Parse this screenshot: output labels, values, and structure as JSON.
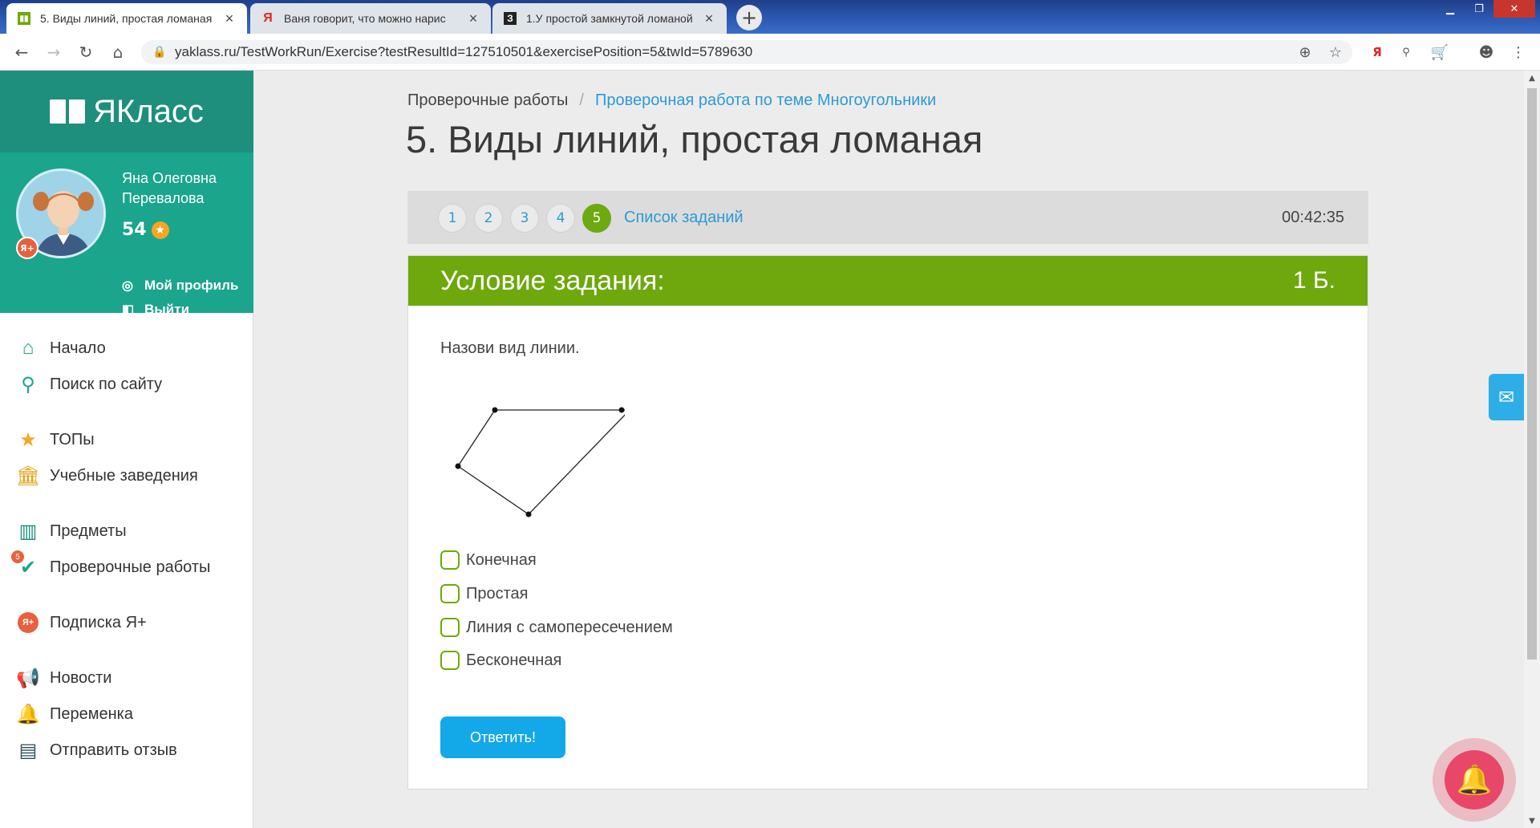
{
  "browser": {
    "tabs": [
      {
        "title": "5. Виды линий, простая ломаная",
        "favicon": "Я"
      },
      {
        "title": "Ваня говорит, что можно нарис",
        "favicon": "Я"
      },
      {
        "title": "1.У простой замкнутой ломаной",
        "favicon": "З"
      }
    ],
    "new_tab": "+",
    "url": "yaklass.ru/TestWorkRun/Exercise?testResultId=127510501&exercisePosition=5&twId=5789630",
    "yandex_label": "Я"
  },
  "sidebar": {
    "logo": "ЯКласс",
    "user_name": "Яна Олеговна Перевалова",
    "score": "54",
    "badge": "Я+",
    "profile_link": "Мой профиль",
    "logout_link": "Выйти",
    "menu": [
      {
        "label": "Начало",
        "icon": "home-icon"
      },
      {
        "label": "Поиск по сайту",
        "icon": "search-icon"
      },
      {
        "label": "ТОПы",
        "icon": "star-icon"
      },
      {
        "label": "Учебные заведения",
        "icon": "school-icon"
      },
      {
        "label": "Предметы",
        "icon": "books-icon"
      },
      {
        "label": "Проверочные работы",
        "icon": "check-icon",
        "count": "5"
      },
      {
        "label": "Подписка Я+",
        "icon": "subscription-icon"
      },
      {
        "label": "Новости",
        "icon": "megaphone-icon"
      },
      {
        "label": "Переменка",
        "icon": "bell-icon"
      },
      {
        "label": "Отправить отзыв",
        "icon": "feedback-icon"
      }
    ]
  },
  "main": {
    "breadcrumb": {
      "root": "Проверочные работы",
      "separator": "/",
      "current": "Проверочная работа по теме Многоугольники"
    },
    "title": "5. Виды линий, простая ломаная",
    "task_numbers": [
      "1",
      "2",
      "3",
      "4",
      "5"
    ],
    "current_task": "5",
    "task_list_link": "Список заданий",
    "timer": "00:42:35",
    "card": {
      "header": "Условие задания:",
      "points": "1 Б.",
      "question": "Назови вид линии.",
      "options": [
        "Конечная",
        "Простая",
        "Линия с самопересечением",
        "Бесконечная"
      ],
      "answer_button": "Ответить!"
    }
  },
  "colors": {
    "teal": "#1aa58c",
    "green": "#6ea80c",
    "blue": "#13a8e8",
    "link": "#2b9bd3"
  }
}
